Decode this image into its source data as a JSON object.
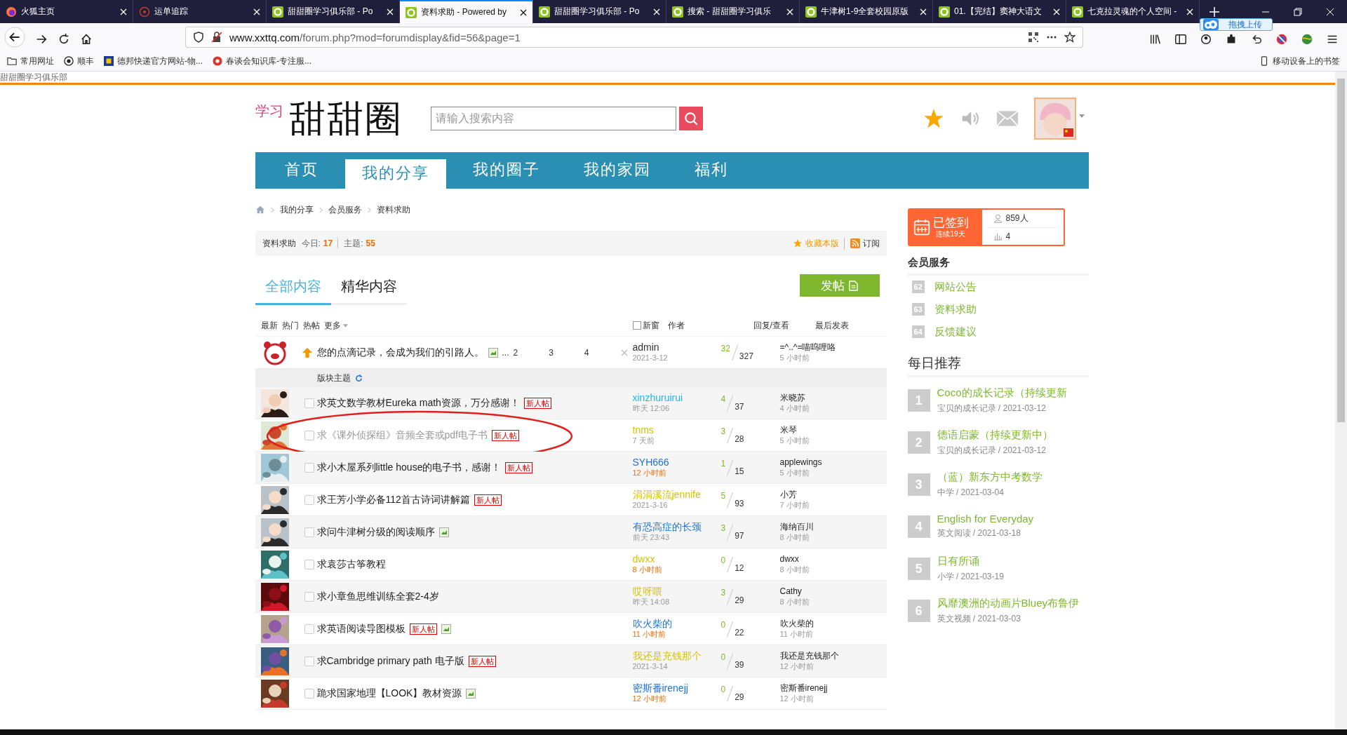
{
  "browser": {
    "tabs": [
      {
        "title": "火狐主页",
        "selected": false
      },
      {
        "title": "运单追踪",
        "selected": false
      },
      {
        "title": "甜甜圈学习俱乐部 - Po",
        "selected": false
      },
      {
        "title": "资料求助 - Powered by",
        "selected": true
      },
      {
        "title": "甜甜圈学习俱乐部 - Po",
        "selected": false
      },
      {
        "title": "搜索 - 甜甜圈学习俱乐",
        "selected": false
      },
      {
        "title": "牛津树1-9全套校园原版",
        "selected": false
      },
      {
        "title": "01.【完结】窦神大语文",
        "selected": false
      },
      {
        "title": "七克拉灵魂的个人空间 -",
        "selected": false
      }
    ],
    "url_host": "www.xxttq.com",
    "url_path": "/forum.php?mod=forumdisplay&fid=56&page=1",
    "bookmarks": [
      "常用网址",
      "顺丰",
      "德邦快递官方网站-物...",
      "春谈会知识库-专注服..."
    ],
    "mobile_bookmarks": "移动设备上的书签",
    "upload_badge": "拖拽上传"
  },
  "page_title": "甜甜圈学习俱乐部",
  "logo": {
    "small": "学习",
    "main": "甜甜圈"
  },
  "search": {
    "placeholder": "请输入搜索内容"
  },
  "nav": [
    {
      "label": "首页",
      "selected": false
    },
    {
      "label": "我的分享",
      "selected": true
    },
    {
      "label": "我的圈子",
      "selected": false
    },
    {
      "label": "我的家园",
      "selected": false
    },
    {
      "label": "福利",
      "selected": false
    }
  ],
  "breadcrumb": [
    "我的分享",
    "会员服务",
    "资料求助"
  ],
  "forum": {
    "name": "资料求助",
    "today_label": "今日:",
    "today": "17",
    "topics_label": "主题:",
    "topics": "55",
    "favorite": "收藏本版",
    "subscribe": "订阅"
  },
  "content_tabs": [
    {
      "label": "全部内容",
      "selected": true
    },
    {
      "label": "精华内容",
      "selected": false
    }
  ],
  "post_button": "发帖",
  "filters": [
    "最新",
    "热门",
    "热帖",
    "更多"
  ],
  "new_window": {
    "label": "新窗",
    "checked": false
  },
  "columns": [
    "作者",
    "回复/查看",
    "最后发表"
  ],
  "pinned": {
    "title": "您的点滴记录，会成为我们的引路人。",
    "has_image": true,
    "pages_prefix": "...",
    "pages": [
      "2",
      "3",
      "4"
    ],
    "author": "admin",
    "date": "2021-3-12",
    "replies": "32",
    "views": "327",
    "last_poster": "=^..^=喵呜哩咯",
    "last_time": "5 小时前"
  },
  "section_label": "版块主题",
  "threads": [
    {
      "title": "求英文数学教材Eureka math资源，万分感谢！",
      "new_badge": "新人帖",
      "has_image": false,
      "visited": false,
      "circled": false,
      "author": "xinzhuruirui",
      "color": "#1fb8ee",
      "date": "昨天 12:06",
      "recent": false,
      "replies": "4",
      "views": "37",
      "last_poster": "米晓苏",
      "last_time": "4 小时前"
    },
    {
      "title": "求《课外侦探组》音频全套或pdf电子书",
      "new_badge": "新人帖",
      "has_image": false,
      "visited": true,
      "circled": true,
      "author": "tnms",
      "color": "#d4c300",
      "date": "7 天前",
      "recent": false,
      "replies": "3",
      "views": "28",
      "last_poster": "米琴",
      "last_time": "5 小时前"
    },
    {
      "title": "求小木屋系列little house的电子书，感谢！",
      "new_badge": "新人帖",
      "has_image": false,
      "visited": false,
      "circled": false,
      "author": "SYH666",
      "color": "#1a73d9",
      "date": "12 小时前",
      "recent": true,
      "replies": "1",
      "views": "15",
      "last_poster": "applewings",
      "last_time": "5 小时前"
    },
    {
      "title": "求王芳小学必备112首古诗词讲解篇",
      "new_badge": "新人帖",
      "has_image": false,
      "visited": false,
      "circled": false,
      "author": "涓涓溪流jennife",
      "color": "#d4c300",
      "date": "2021-3-16",
      "recent": false,
      "replies": "5",
      "views": "93",
      "last_poster": "小芳",
      "last_time": "7 小时前"
    },
    {
      "title": "求问牛津树分级的阅读顺序",
      "has_image": true,
      "visited": false,
      "circled": false,
      "author": "有恐高症的长颈",
      "color": "#1a73d9",
      "date": "前天 23:43",
      "recent": false,
      "replies": "3",
      "views": "97",
      "last_poster": "海纳百川",
      "last_time": "8 小时前"
    },
    {
      "title": "求袁莎古筝教程",
      "has_image": false,
      "visited": false,
      "circled": false,
      "author": "dwxx",
      "color": "#d4c300",
      "date": "8 小时前",
      "recent": true,
      "replies": "0",
      "views": "12",
      "last_poster": "dwxx",
      "last_time": "8 小时前"
    },
    {
      "title": "求小章鱼思维训练全套2-4岁",
      "has_image": false,
      "visited": false,
      "circled": false,
      "author": "哎呀喂",
      "color": "#d4c300",
      "date": "昨天 14:08",
      "recent": false,
      "replies": "3",
      "views": "29",
      "last_poster": "Cathy",
      "last_time": "8 小时前"
    },
    {
      "title": "求英语阅读导图模板",
      "new_badge": "新人帖",
      "has_image": true,
      "visited": false,
      "circled": false,
      "author": "吹火柴的",
      "color": "#1a73d9",
      "date": "11 小时前",
      "recent": true,
      "replies": "0",
      "views": "22",
      "last_poster": "吹火柴的",
      "last_time": "11 小时前"
    },
    {
      "title": "求Cambridge primary path 电子版",
      "new_badge": "新人帖",
      "has_image": false,
      "visited": false,
      "circled": false,
      "author": "我还是充钱那个",
      "color": "#d4c300",
      "date": "2021-3-14",
      "recent": false,
      "replies": "0",
      "views": "39",
      "last_poster": "我还是充钱那个",
      "last_time": "12 小时前"
    },
    {
      "title": "跪求国家地理【LOOK】教材资源",
      "has_image": true,
      "visited": false,
      "circled": false,
      "author": "密斯番irenejj",
      "color": "#1a73d9",
      "date": "12 小时前",
      "recent": true,
      "replies": "0",
      "views": "29",
      "last_poster": "密斯番irenejj",
      "last_time": "12 小时前"
    }
  ],
  "signin": {
    "status": "已签到",
    "streak": "连续19天",
    "people": "859人",
    "rank": "4"
  },
  "services": {
    "title": "会员服务",
    "items": [
      {
        "number": "62",
        "label": "网站公告"
      },
      {
        "number": "63",
        "label": "资料求助"
      },
      {
        "number": "64",
        "label": "反馈建议"
      }
    ]
  },
  "daily": {
    "title": "每日推荐",
    "items": [
      {
        "rank": "1",
        "title": "Coco的成长记录（持续更新",
        "meta": "宝贝的成长记录 / 2021-03-12"
      },
      {
        "rank": "2",
        "title": "德语启蒙（持续更新中）",
        "meta": "宝贝的成长记录 / 2021-03-12"
      },
      {
        "rank": "3",
        "title": "（蓝）新东方中考数学",
        "meta": "中学 / 2021-03-04"
      },
      {
        "rank": "4",
        "title": "English for Everyday",
        "meta": "英文阅读 / 2021-03-18"
      },
      {
        "rank": "5",
        "title": "日有所诵",
        "meta": "小学 / 2021-03-19"
      },
      {
        "rank": "6",
        "title": "风靡澳洲的动画片Bluey布鲁伊",
        "meta": "英文视频 / 2021-03-03"
      }
    ]
  }
}
